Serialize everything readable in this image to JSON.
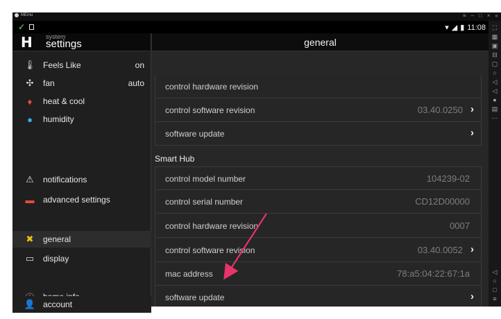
{
  "emulator": {
    "title": "MEmu",
    "controls": [
      "≡",
      "–",
      "□",
      "×",
      "«"
    ]
  },
  "status_bar": {
    "time": "11:08",
    "icons": [
      "wifi-icon",
      "signal-icon",
      "battery-icon"
    ]
  },
  "sidebar": {
    "breadcrumb_small": "system",
    "breadcrumb_big": "settings",
    "items": [
      {
        "label": "Feels Like",
        "value": "on",
        "icon": "thermometer-icon"
      },
      {
        "label": "fan",
        "value": "auto",
        "icon": "fan-icon"
      },
      {
        "label": "heat & cool",
        "value": "",
        "icon": "heat-cool-icon"
      },
      {
        "label": "humidity",
        "value": "",
        "icon": "droplet-icon"
      },
      {
        "label": "notifications",
        "value": "",
        "icon": "warning-icon"
      },
      {
        "label": "advanced settings",
        "value": "",
        "icon": "toolbox-icon"
      },
      {
        "label": "general",
        "value": "",
        "icon": "tools-icon"
      },
      {
        "label": "display",
        "value": "",
        "icon": "display-icon"
      },
      {
        "label": "home info",
        "value": "",
        "icon": "info-icon"
      },
      {
        "label": "account",
        "value": "",
        "icon": "person-icon"
      }
    ],
    "active": "general"
  },
  "main": {
    "title": "general",
    "top_rows": [
      {
        "label": "control hardware revision",
        "value": ""
      },
      {
        "label": "control software revision",
        "value": "03.40.0250",
        "chevron": true
      },
      {
        "label": "software update",
        "value": "",
        "chevron": true
      }
    ],
    "section": "Smart Hub",
    "hub_rows": [
      {
        "label": "control model number",
        "value": "104239-02"
      },
      {
        "label": "control serial number",
        "value": "CD12D00000"
      },
      {
        "label": "control hardware revision",
        "value": "0007"
      },
      {
        "label": "control software revision",
        "value": "03.40.0052",
        "chevron": true
      },
      {
        "label": "mac address",
        "value": "78:a5:04:22:67:1a"
      },
      {
        "label": "software update",
        "value": "",
        "chevron": true
      }
    ]
  },
  "colors": {
    "annotation_arrow": "#e8336b",
    "accent_check": "#4caf50"
  }
}
